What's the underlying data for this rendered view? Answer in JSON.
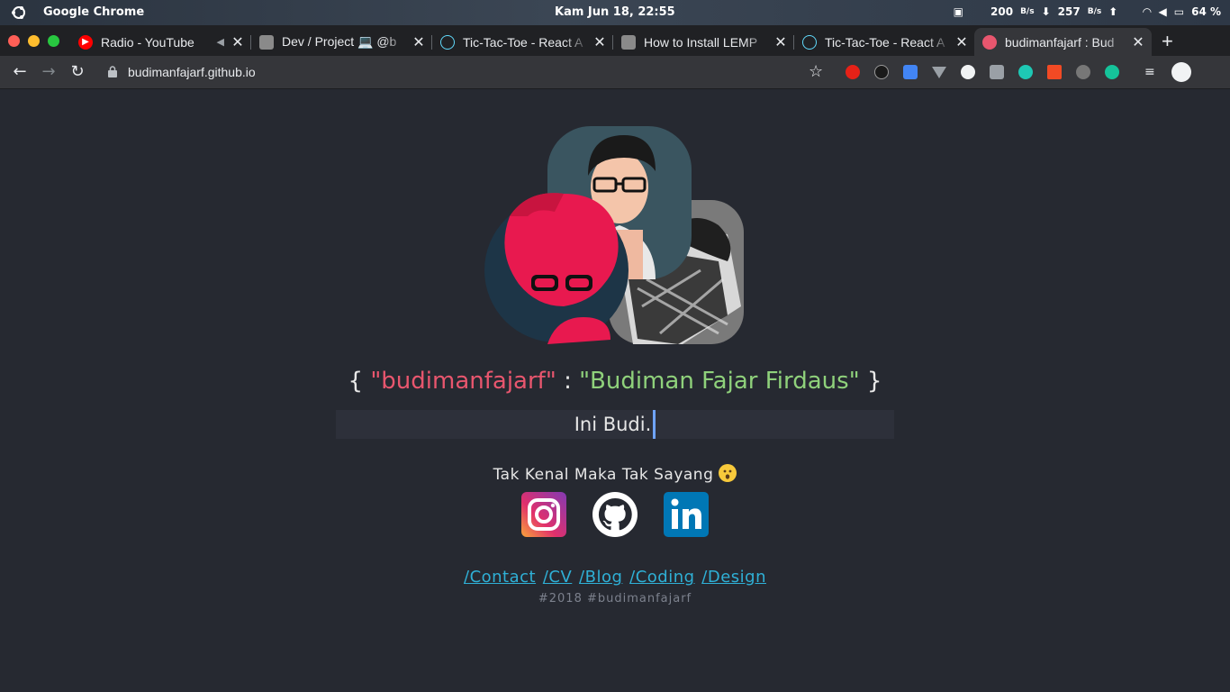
{
  "os": {
    "app_name": "Google Chrome",
    "clock": "Kam Jun 18, 22:55",
    "net_down": "200",
    "net_down_unit": "B/s",
    "net_up": "257",
    "net_up_unit": "B/s",
    "battery": "64 %"
  },
  "tabs": [
    {
      "title": "Radio - YouTube",
      "favicon": "youtube-icon",
      "color": "#ff0000"
    },
    {
      "title": "Dev / Project 💻 @b",
      "favicon": "profile-icon",
      "color": "#888888"
    },
    {
      "title": "Tic-Tac-Toe - React A",
      "favicon": "react-icon",
      "color": "#61dafb"
    },
    {
      "title": "How to Install LEMP",
      "favicon": "profile-icon",
      "color": "#888888"
    },
    {
      "title": "Tic-Tac-Toe - React A",
      "favicon": "react-icon",
      "color": "#61dafb"
    },
    {
      "title": "budimanfajarf : Bud",
      "favicon": "site-icon",
      "color": "#e8566e"
    }
  ],
  "address": {
    "url": "budimanfajarf.github.io"
  },
  "extensions": [
    "adblock-icon",
    "gnome-icon",
    "translate-icon",
    "vue-icon",
    "clock-icon",
    "camera-icon",
    "m-icon",
    "chart-icon",
    "shield-icon",
    "grammarly-icon",
    "media-icon",
    "profile-icon"
  ],
  "page": {
    "brace_open": "{",
    "key": "\"budimanfajarf\"",
    "colon": ":",
    "value": "\"Budiman Fajar Firdaus\"",
    "brace_close": "}",
    "typed_text": "Ini Budi.",
    "tagline": "Tak Kenal Maka Tak Sayang",
    "social": [
      "instagram-icon",
      "github-icon",
      "linkedin-icon"
    ],
    "nav_links": [
      "/Contact",
      "/CV",
      "/Blog",
      "/Coding",
      "/Design"
    ],
    "footer": "#2018 #budimanfajarf"
  },
  "colors": {
    "key": "#e8566e",
    "value": "#8fd17b",
    "link": "#2fb0d6",
    "accent_red": "#e8194f"
  }
}
